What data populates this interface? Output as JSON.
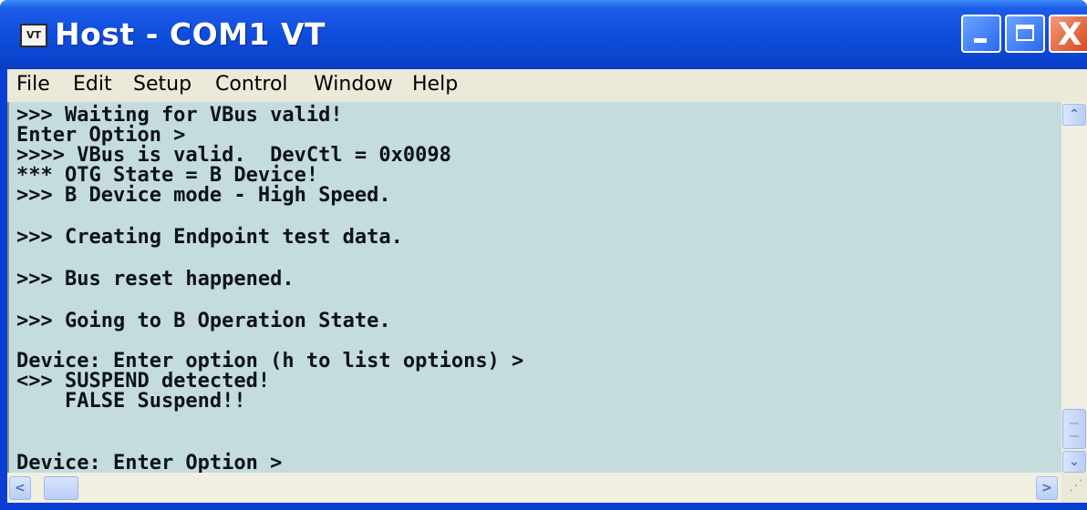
{
  "window": {
    "title": "Host - COM1 VT",
    "icon_text": "VT",
    "close_glyph": "X"
  },
  "menu": [
    "File",
    "Edit",
    "Setup",
    "Control",
    "Window",
    "Help"
  ],
  "terminal": {
    "lines": [
      ">>> Waiting for VBus valid!",
      "Enter Option >",
      ">>>> VBus is valid.  DevCtl = 0x0098",
      "*** OTG State = B Device!",
      ">>> B Device mode - High Speed.",
      ">>> Creating Endpoint test data.",
      ">>> Bus reset happened.",
      ">>> Going to B Operation State.",
      "Device: Enter option (h to list options) >",
      "<>> SUSPEND detected!",
      "    FALSE Suspend!!",
      "Device: Enter Option >"
    ]
  },
  "scrollbars": {
    "up_glyph": "⌃",
    "down_glyph": "⌄",
    "left_glyph": "<",
    "right_glyph": ">"
  }
}
